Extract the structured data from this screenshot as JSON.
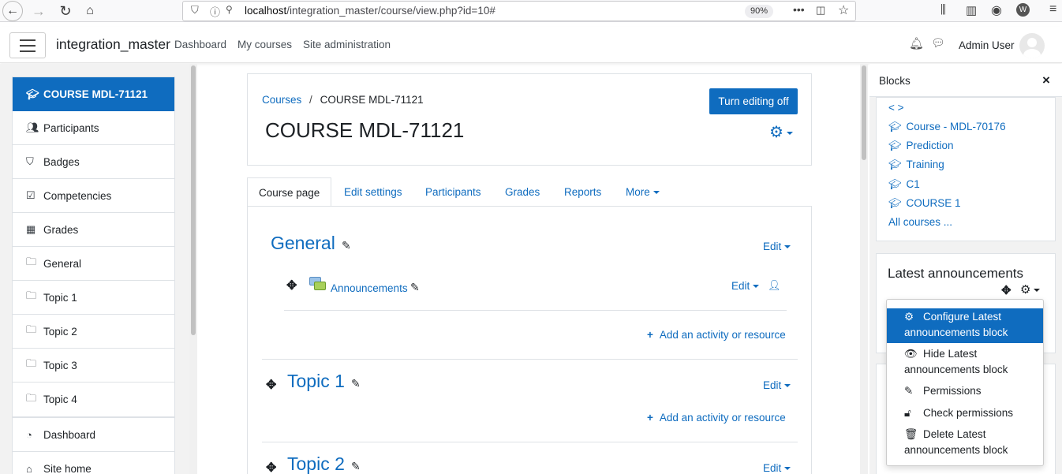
{
  "browser": {
    "url_host": "localhost",
    "url_path": "/integration_master/course/view.php?id=10#",
    "zoom": "90%"
  },
  "navbar": {
    "site_name": "integration_master",
    "links": [
      "Dashboard",
      "My courses",
      "Site administration"
    ],
    "user_name": "Admin User"
  },
  "drawer": {
    "course": "COURSE MDL-71121",
    "items": [
      "Participants",
      "Badges",
      "Competencies",
      "Grades",
      "General",
      "Topic 1",
      "Topic 2",
      "Topic 3",
      "Topic 4"
    ],
    "items2": [
      "Dashboard",
      "Site home"
    ]
  },
  "header": {
    "breadcrumb_root": "Courses",
    "breadcrumb_sep": "/",
    "breadcrumb_current": "COURSE MDL-71121",
    "title": "COURSE MDL-71121",
    "turn_editing": "Turn editing off"
  },
  "tabs": [
    "Course page",
    "Edit settings",
    "Participants",
    "Grades",
    "Reports",
    "More"
  ],
  "sections": {
    "general": "General",
    "edit": "Edit",
    "announcements": "Announcements",
    "add_activity": "Add an activity or resource",
    "topic1": "Topic 1",
    "topic2": "Topic 2"
  },
  "blocks": {
    "title": "Blocks",
    "close": "×",
    "courses_more": "< >",
    "courses": [
      "Course - MDL-70176",
      "Prediction",
      "Training",
      "C1",
      "COURSE 1"
    ],
    "all_courses": "All courses ...",
    "latest_title": "Latest announcements"
  },
  "dropdown": {
    "items": [
      {
        "icon": "⚙",
        "line1": "Configure Latest",
        "line2": "announcements block"
      },
      {
        "icon": "👁",
        "line1": "Hide Latest",
        "line2": "announcements block"
      },
      {
        "icon": "✎",
        "line1": "Permissions",
        "line2": ""
      },
      {
        "icon": "🔓",
        "line1": "Check permissions",
        "line2": ""
      },
      {
        "icon": "🗑",
        "line1": "Delete Latest",
        "line2": "announcements block"
      }
    ]
  },
  "colors": {
    "primary": "#0f6cbf",
    "text": "#1d2125"
  }
}
